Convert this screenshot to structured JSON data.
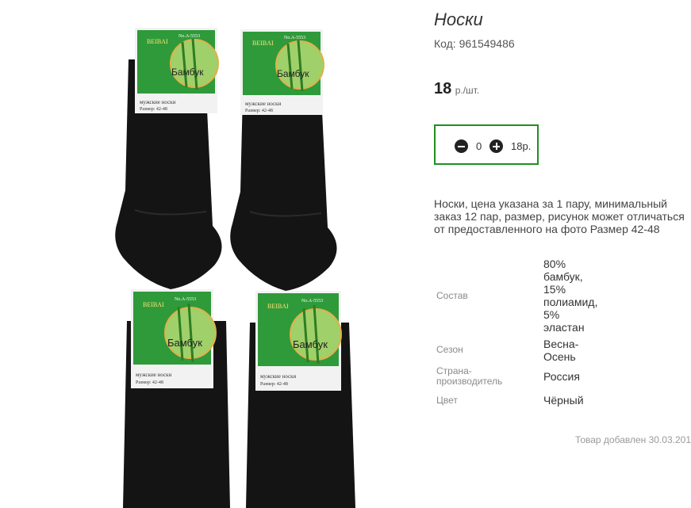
{
  "product": {
    "title": "Носки",
    "code": "Код: 961549486",
    "price": "18",
    "price_unit": "р./шт.",
    "description": "Носки, цена указана за 1 пару, минимальный заказ 12 пар, размер, рисунок может отличаться от предоставленного на фото Размер 42-48",
    "added": "Товар добавлен 30.03.201"
  },
  "quantity": {
    "value": "0",
    "total": "18р."
  },
  "attributes": {
    "composition_label": "Состав",
    "composition_lines": [
      "80%",
      "бамбук,",
      "15%",
      "полиамид,",
      "5%",
      "эластан"
    ],
    "season_label": "Сезон",
    "season_lines": [
      "Весна-",
      "Осень"
    ],
    "country_label_lines": [
      "Страна-",
      "производитель"
    ],
    "country_value": "Россия",
    "color_label": "Цвет",
    "color_value": "Чёрный"
  },
  "tag": {
    "brand": "BEIBAI",
    "line": "Бамбук",
    "type": "мужские носки",
    "size": "Размер: 42-48",
    "article": "No.A-5553"
  },
  "colors": {
    "frame": "#1f8f1f",
    "sock": "#141414",
    "tag_green": "#2f9a3a"
  }
}
